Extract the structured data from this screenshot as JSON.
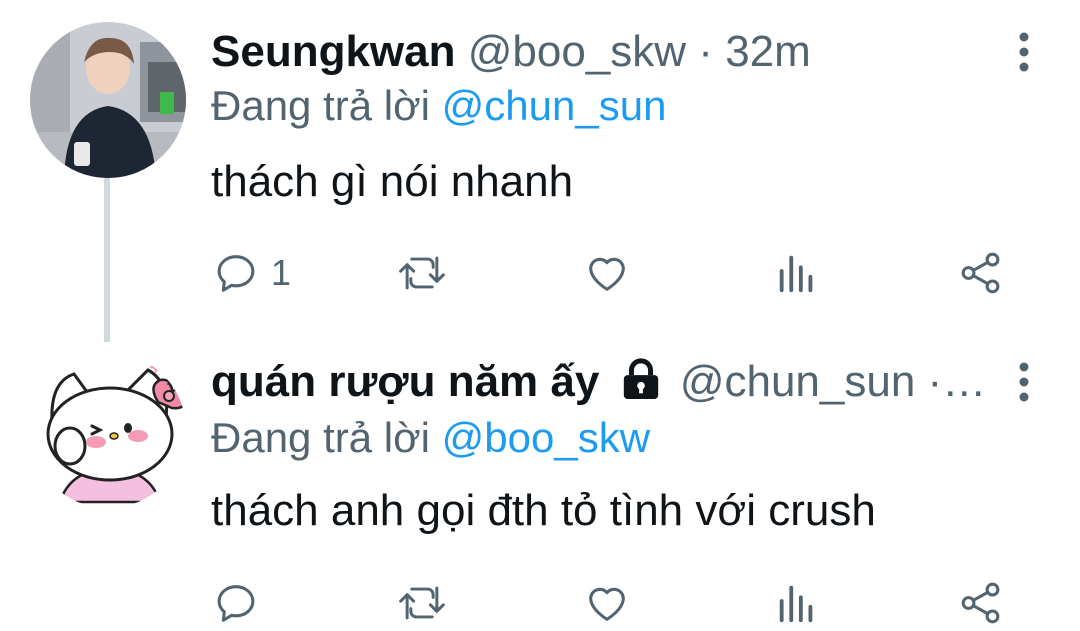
{
  "tweets": [
    {
      "name": "Seungkwan",
      "handle": "@boo_skw",
      "separator": "·",
      "time": "32m",
      "reply_label": "Đang trả lời",
      "reply_mention": "@chun_sun",
      "text": "thách gì nói nhanh",
      "reply_count": "1",
      "icons": [
        "reply-icon",
        "retweet-icon",
        "like-icon",
        "views-icon",
        "share-icon",
        "more-icon"
      ]
    },
    {
      "name": "quán rượu năm ấy",
      "handle": "@chun_sun",
      "separator": "·…",
      "reply_label": "Đang trả lời",
      "reply_mention": "@boo_skw",
      "text": "thách anh gọi đth tỏ tình với crush",
      "reply_count": "",
      "icons": [
        "reply-icon",
        "retweet-icon",
        "like-icon",
        "views-icon",
        "share-icon",
        "more-icon",
        "lock-icon"
      ]
    }
  ],
  "colors": {
    "text": "#0f1419",
    "secondary": "#536471",
    "link": "#1d9bf0",
    "thread_line": "#cfd9de"
  }
}
